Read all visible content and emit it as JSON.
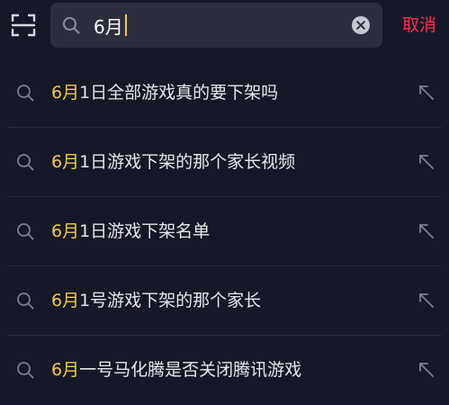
{
  "search": {
    "query": "6月",
    "cancel_label": "取消"
  },
  "suggestions": [
    {
      "highlight": "6月",
      "rest": "1日全部游戏真的要下架吗"
    },
    {
      "highlight": "6月",
      "rest": "1日游戏下架的那个家长视频"
    },
    {
      "highlight": "6月",
      "rest": "1日游戏下架名单"
    },
    {
      "highlight": "6月",
      "rest": "1号游戏下架的那个家长"
    },
    {
      "highlight": "6月",
      "rest": "一号马化腾是否关闭腾讯游戏"
    }
  ],
  "colors": {
    "background": "#151826",
    "search_box": "#2b2e3c",
    "highlight": "#f2c94c",
    "cancel": "#fe2c55"
  },
  "icons": {
    "scan": "scan-icon",
    "search": "search-icon",
    "clear": "clear-icon",
    "suggestion": "search-icon",
    "fill_query": "arrow-up-left-icon"
  }
}
